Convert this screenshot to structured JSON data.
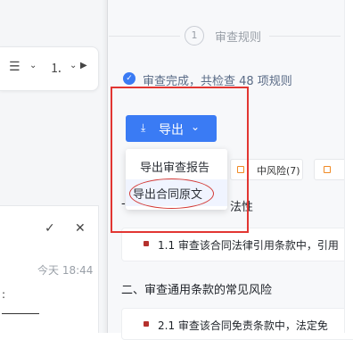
{
  "left_panel": {
    "toolbar": {
      "list_icon": "bullet-list-icon",
      "numbered_icon": "numbered-list-icon",
      "more_icon": "play-right-icon"
    },
    "comment": {
      "timestamp": "今天 18:44",
      "fragment": ":"
    }
  },
  "review": {
    "step_number": "1",
    "step_label": "审查规则",
    "status": "审查完成，共检查 48 项规则",
    "export_button": "导出",
    "export_menu": [
      "导出审查报告",
      "导出合同原文"
    ],
    "risk_tags": [
      "中风险(7)",
      ""
    ],
    "section1_partial": "法性",
    "rule1": "1.1 审查该合同法律引用条款中，引用",
    "section2": "二、审查通用条款的常见风险",
    "rule2": "2.1 审查该合同免责条款中，法定免"
  },
  "colors": {
    "accent": "#3a7bf4",
    "highlight_red": "#e23632",
    "risk_red": "#b5312d",
    "risk_orange": "#f08a24"
  }
}
